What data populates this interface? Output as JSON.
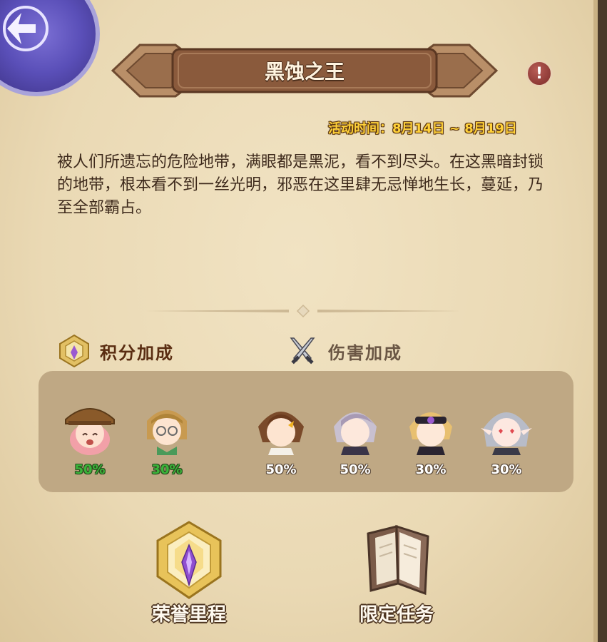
{
  "header": {
    "title": "黑蚀之王",
    "info_symbol": "!",
    "event_time": "活动时间：8月14日 ~ 8月19日"
  },
  "description": "被人们所遗忘的危险地带，满眼都是黑泥，看不到尽头。在这黑暗封锁的地带，根本看不到一丝光明，邪恶在这里肆无忌惮地生长，蔓延，乃至全部霸占。",
  "bonuses": {
    "points_label": "积分加成",
    "damage_label": "伤害加成",
    "points_heroes": [
      {
        "pct": "50%",
        "hair": "#f2a0a8",
        "hat": "#8a5a2a"
      },
      {
        "pct": "30%",
        "hair": "#c89a50",
        "hat": ""
      }
    ],
    "damage_heroes": [
      {
        "pct": "50%",
        "hair": "#7a4a2a"
      },
      {
        "pct": "50%",
        "hair": "#c8c0d0"
      },
      {
        "pct": "30%",
        "hair": "#e8c070"
      },
      {
        "pct": "30%",
        "hair": "#b8bcc8"
      }
    ]
  },
  "features": {
    "honor_label": "荣誉里程",
    "quest_label": "限定任务"
  },
  "colors": {
    "accent_gold": "#ffd13a",
    "bonus_green": "#3bb43a",
    "banner_brown": "#8a5a3c"
  }
}
